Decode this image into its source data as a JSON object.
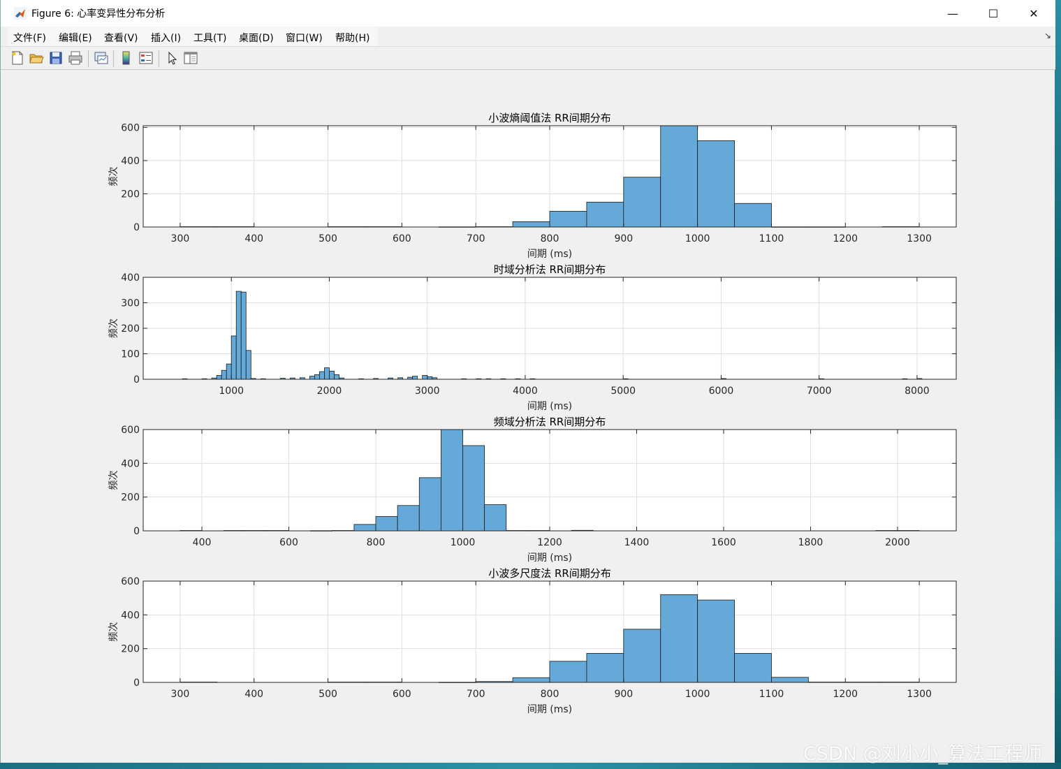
{
  "window": {
    "title": "Figure 6: 心率变异性分布分析",
    "min_glyph": "—",
    "max_glyph": "☐",
    "close_glyph": "✕"
  },
  "menu": [
    "文件(F)",
    "编辑(E)",
    "查看(V)",
    "插入(I)",
    "工具(T)",
    "桌面(D)",
    "窗口(W)",
    "帮助(H)"
  ],
  "toolbar_icons": [
    "new-figure-icon",
    "open-file-icon",
    "save-icon",
    "print-icon",
    "link-plot-icon",
    "colorbar-icon",
    "legend-icon",
    "edit-plot-icon",
    "property-inspector-icon"
  ],
  "dock_glyph": "↘",
  "watermark": "CSDN @刘小小_算法工程师",
  "colors": {
    "bar_fill": "#64a9d8",
    "bar_edge": "#1a1a1a",
    "grid": "#dfdfdf",
    "axes_bg": "#ffffff",
    "figure_bg": "#f0f0f0"
  },
  "chart_data": [
    {
      "type": "bar",
      "title": "小波熵阈值法 RR间期分布",
      "xlabel": "间期 (ms)",
      "ylabel": "频次",
      "xlim": [
        250,
        1350
      ],
      "ylim": [
        0,
        610
      ],
      "xticks": [
        300,
        400,
        500,
        600,
        700,
        800,
        900,
        1000,
        1100,
        1200,
        1300
      ],
      "yticks": [
        0,
        200,
        400,
        600
      ],
      "grid": true,
      "bin_width": 50,
      "bins": [
        [
          300,
          2
        ],
        [
          350,
          2
        ],
        [
          500,
          2
        ],
        [
          550,
          2
        ],
        [
          650,
          1
        ],
        [
          700,
          2
        ],
        [
          750,
          32
        ],
        [
          800,
          95
        ],
        [
          850,
          150
        ],
        [
          900,
          300
        ],
        [
          950,
          610
        ],
        [
          1000,
          520
        ],
        [
          1050,
          142
        ],
        [
          1100,
          1
        ],
        [
          1150,
          1
        ],
        [
          1250,
          2
        ]
      ]
    },
    {
      "type": "bar",
      "title": "时域分析法 RR间期分布",
      "xlabel": "间期 (ms)",
      "ylabel": "频次",
      "xlim": [
        100,
        8400
      ],
      "ylim": [
        0,
        400
      ],
      "xticks": [
        1000,
        2000,
        3000,
        4000,
        5000,
        6000,
        7000,
        8000
      ],
      "yticks": [
        0,
        100,
        200,
        300,
        400
      ],
      "grid": true,
      "bin_width": 50,
      "bins": [
        [
          500,
          2
        ],
        [
          700,
          2
        ],
        [
          800,
          5
        ],
        [
          850,
          15
        ],
        [
          900,
          35
        ],
        [
          950,
          60
        ],
        [
          1000,
          170
        ],
        [
          1050,
          345
        ],
        [
          1100,
          342
        ],
        [
          1150,
          113
        ],
        [
          1200,
          3
        ],
        [
          1300,
          2
        ],
        [
          1500,
          4
        ],
        [
          1600,
          5
        ],
        [
          1700,
          6
        ],
        [
          1800,
          12
        ],
        [
          1850,
          18
        ],
        [
          1900,
          30
        ],
        [
          1950,
          45
        ],
        [
          2000,
          32
        ],
        [
          2050,
          18
        ],
        [
          2100,
          5
        ],
        [
          2300,
          2
        ],
        [
          2450,
          3
        ],
        [
          2600,
          5
        ],
        [
          2700,
          6
        ],
        [
          2800,
          8
        ],
        [
          2850,
          12
        ],
        [
          2950,
          15
        ],
        [
          3000,
          10
        ],
        [
          3050,
          6
        ],
        [
          3350,
          2
        ],
        [
          3500,
          2
        ],
        [
          3600,
          2
        ],
        [
          3750,
          2
        ],
        [
          3900,
          2
        ],
        [
          4050,
          2
        ],
        [
          5000,
          2
        ],
        [
          6000,
          3
        ],
        [
          7000,
          2
        ],
        [
          7850,
          2
        ],
        [
          8000,
          3
        ]
      ]
    },
    {
      "type": "bar",
      "title": "频域分析法 RR间期分布",
      "xlabel": "间期 (ms)",
      "ylabel": "频次",
      "xlim": [
        265,
        2135
      ],
      "ylim": [
        0,
        600
      ],
      "xticks": [
        400,
        600,
        800,
        1000,
        1200,
        1400,
        1600,
        1800,
        2000
      ],
      "yticks": [
        0,
        200,
        400,
        600
      ],
      "grid": true,
      "bin_width": 50,
      "bins": [
        [
          350,
          2
        ],
        [
          450,
          2
        ],
        [
          500,
          2
        ],
        [
          550,
          2
        ],
        [
          650,
          1
        ],
        [
          700,
          2
        ],
        [
          750,
          38
        ],
        [
          800,
          85
        ],
        [
          850,
          150
        ],
        [
          900,
          315
        ],
        [
          950,
          600
        ],
        [
          1000,
          505
        ],
        [
          1050,
          155
        ],
        [
          1100,
          2
        ],
        [
          1150,
          2
        ],
        [
          1250,
          3
        ],
        [
          1950,
          2
        ],
        [
          2000,
          2
        ]
      ]
    },
    {
      "type": "bar",
      "title": "小波多尺度法 RR间期分布",
      "xlabel": "间期 (ms)",
      "ylabel": "频次",
      "xlim": [
        250,
        1350
      ],
      "ylim": [
        0,
        600
      ],
      "xticks": [
        300,
        400,
        500,
        600,
        700,
        800,
        900,
        1000,
        1100,
        1200,
        1300
      ],
      "yticks": [
        0,
        200,
        400,
        600
      ],
      "grid": true,
      "bin_width": 50,
      "bins": [
        [
          300,
          2
        ],
        [
          500,
          2
        ],
        [
          550,
          2
        ],
        [
          650,
          1
        ],
        [
          700,
          5
        ],
        [
          750,
          28
        ],
        [
          800,
          125
        ],
        [
          850,
          172
        ],
        [
          900,
          315
        ],
        [
          950,
          520
        ],
        [
          1000,
          488
        ],
        [
          1050,
          172
        ],
        [
          1100,
          30
        ],
        [
          1150,
          2
        ],
        [
          1200,
          2
        ],
        [
          1250,
          2
        ]
      ]
    }
  ]
}
